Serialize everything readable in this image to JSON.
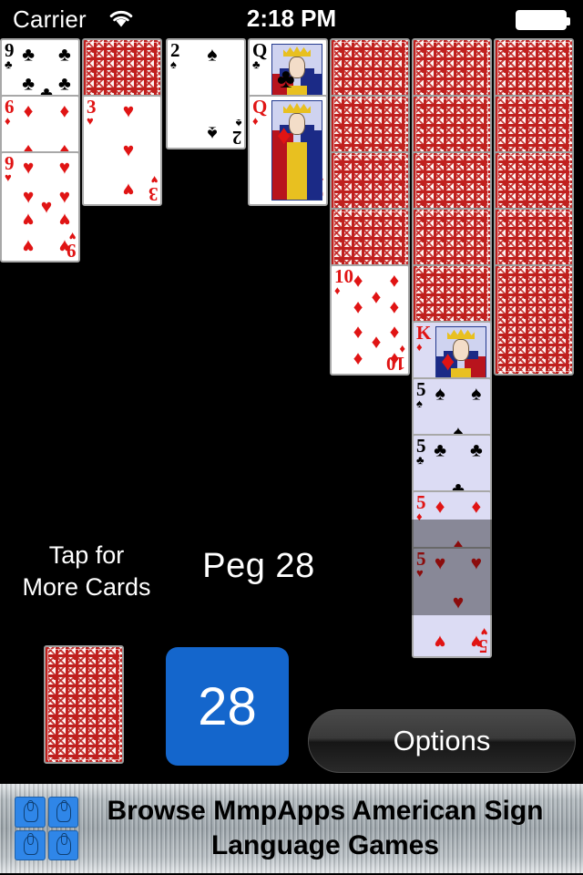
{
  "status_bar": {
    "carrier": "Carrier",
    "wifi_icon": "wifi-icon",
    "time": "2:18 PM",
    "battery_icon": "battery-full-icon"
  },
  "game": {
    "peg_label": "Peg 28",
    "tap_more_line1": "Tap for",
    "tap_more_line2": "More Cards",
    "count_value": "28",
    "options_label": "Options",
    "deck_icon": "card-back-icon"
  },
  "colors": {
    "table_background": "#000000",
    "card_face": "#ffffff",
    "card_selected": "#dcdcf4",
    "card_back_red": "#c0201e",
    "count_button_blue": "#1466cc",
    "options_button_dark": "#2a2a2a",
    "red_suit": "#e01414",
    "black_suit": "#000000"
  },
  "tableau": {
    "columns": [
      {
        "index": 1,
        "cards": [
          {
            "rank": "9",
            "suit": "clubs",
            "suit_glyph": "♣",
            "color": "black",
            "face_up": true,
            "selected": false
          },
          {
            "rank": "6",
            "suit": "diamonds",
            "suit_glyph": "♦",
            "color": "red",
            "face_up": true,
            "selected": false
          },
          {
            "rank": "9",
            "suit": "hearts",
            "suit_glyph": "♥",
            "color": "red",
            "face_up": true,
            "selected": false
          }
        ]
      },
      {
        "index": 2,
        "cards": [
          {
            "rank": "",
            "suit": "back",
            "suit_glyph": "",
            "color": "",
            "face_up": false,
            "selected": false
          },
          {
            "rank": "3",
            "suit": "hearts",
            "suit_glyph": "♥",
            "color": "red",
            "face_up": true,
            "selected": false
          }
        ]
      },
      {
        "index": 3,
        "cards": [
          {
            "rank": "2",
            "suit": "spades",
            "suit_glyph": "♠",
            "color": "black",
            "face_up": true,
            "selected": false
          }
        ]
      },
      {
        "index": 4,
        "cards": [
          {
            "rank": "Q",
            "suit": "clubs",
            "suit_glyph": "♣",
            "color": "black",
            "face_up": true,
            "selected": false,
            "court": true
          },
          {
            "rank": "Q",
            "suit": "diamonds",
            "suit_glyph": "♦",
            "color": "red",
            "face_up": true,
            "selected": false,
            "court": true
          }
        ]
      },
      {
        "index": 5,
        "cards": [
          {
            "rank": "",
            "suit": "back",
            "suit_glyph": "",
            "color": "",
            "face_up": false,
            "selected": false
          },
          {
            "rank": "",
            "suit": "back",
            "suit_glyph": "",
            "color": "",
            "face_up": false,
            "selected": false
          },
          {
            "rank": "",
            "suit": "back",
            "suit_glyph": "",
            "color": "",
            "face_up": false,
            "selected": false
          },
          {
            "rank": "",
            "suit": "back",
            "suit_glyph": "",
            "color": "",
            "face_up": false,
            "selected": false
          },
          {
            "rank": "10",
            "suit": "diamonds",
            "suit_glyph": "♦",
            "color": "red",
            "face_up": true,
            "selected": false
          }
        ]
      },
      {
        "index": 6,
        "cards": [
          {
            "rank": "",
            "suit": "back",
            "suit_glyph": "",
            "color": "",
            "face_up": false,
            "selected": false
          },
          {
            "rank": "",
            "suit": "back",
            "suit_glyph": "",
            "color": "",
            "face_up": false,
            "selected": false
          },
          {
            "rank": "",
            "suit": "back",
            "suit_glyph": "",
            "color": "",
            "face_up": false,
            "selected": false
          },
          {
            "rank": "",
            "suit": "back",
            "suit_glyph": "",
            "color": "",
            "face_up": false,
            "selected": false
          },
          {
            "rank": "",
            "suit": "back",
            "suit_glyph": "",
            "color": "",
            "face_up": false,
            "selected": false
          },
          {
            "rank": "K",
            "suit": "diamonds",
            "suit_glyph": "♦",
            "color": "red",
            "face_up": true,
            "selected": true,
            "court": true
          },
          {
            "rank": "5",
            "suit": "spades",
            "suit_glyph": "♠",
            "color": "black",
            "face_up": true,
            "selected": true
          },
          {
            "rank": "5",
            "suit": "clubs",
            "suit_glyph": "♣",
            "color": "black",
            "face_up": true,
            "selected": true
          },
          {
            "rank": "5",
            "suit": "diamonds",
            "suit_glyph": "♦",
            "color": "red",
            "face_up": true,
            "selected": true
          },
          {
            "rank": "5",
            "suit": "hearts",
            "suit_glyph": "♥",
            "color": "red",
            "face_up": true,
            "selected": true
          }
        ]
      },
      {
        "index": 7,
        "cards": [
          {
            "rank": "",
            "suit": "back",
            "suit_glyph": "",
            "color": "",
            "face_up": false,
            "selected": false
          },
          {
            "rank": "",
            "suit": "back",
            "suit_glyph": "",
            "color": "",
            "face_up": false,
            "selected": false
          },
          {
            "rank": "",
            "suit": "back",
            "suit_glyph": "",
            "color": "",
            "face_up": false,
            "selected": false
          },
          {
            "rank": "",
            "suit": "back",
            "suit_glyph": "",
            "color": "",
            "face_up": false,
            "selected": false
          },
          {
            "rank": "",
            "suit": "back",
            "suit_glyph": "",
            "color": "",
            "face_up": false,
            "selected": false
          }
        ]
      }
    ]
  },
  "ad": {
    "text_line1": "Browse MmpApps American Sign",
    "text_line2": "Language Games",
    "icon_name": "sign-language-tiles-icon"
  }
}
